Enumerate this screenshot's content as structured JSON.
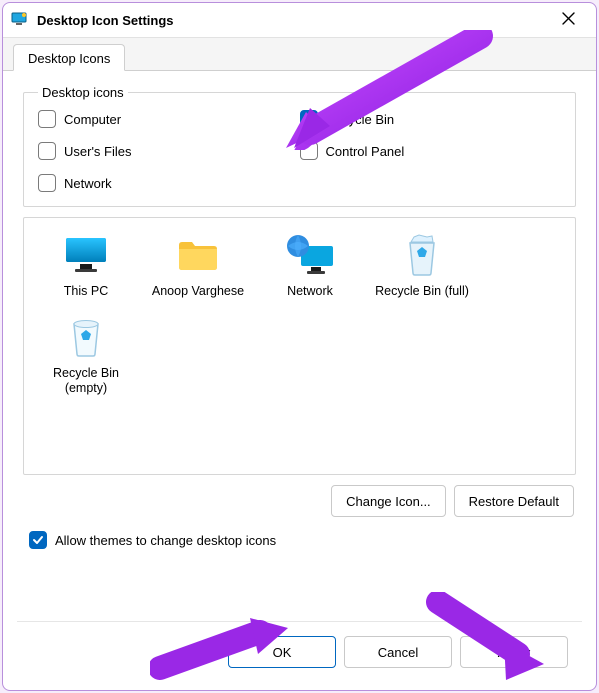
{
  "window": {
    "title": "Desktop Icon Settings"
  },
  "tabs": {
    "desktop_icons": "Desktop Icons"
  },
  "group": {
    "legend": "Desktop icons"
  },
  "checks": {
    "computer": {
      "label": "Computer",
      "checked": false
    },
    "recycle": {
      "label": "Recycle Bin",
      "checked": true
    },
    "users_files": {
      "label": "User's Files",
      "checked": false
    },
    "control_panel": {
      "label": "Control Panel",
      "checked": false
    },
    "network": {
      "label": "Network",
      "checked": false
    }
  },
  "icons": {
    "this_pc": {
      "label": "This PC"
    },
    "user_folder": {
      "label": "Anoop Varghese"
    },
    "network": {
      "label": "Network"
    },
    "recycle_full": {
      "label": "Recycle Bin (full)"
    },
    "recycle_empty": {
      "label": "Recycle Bin (empty)"
    }
  },
  "buttons": {
    "change_icon": "Change Icon...",
    "restore_default": "Restore Default",
    "ok": "OK",
    "cancel": "Cancel",
    "apply": "Apply"
  },
  "themes_check": {
    "label": "Allow themes to change desktop icons",
    "checked": true
  }
}
